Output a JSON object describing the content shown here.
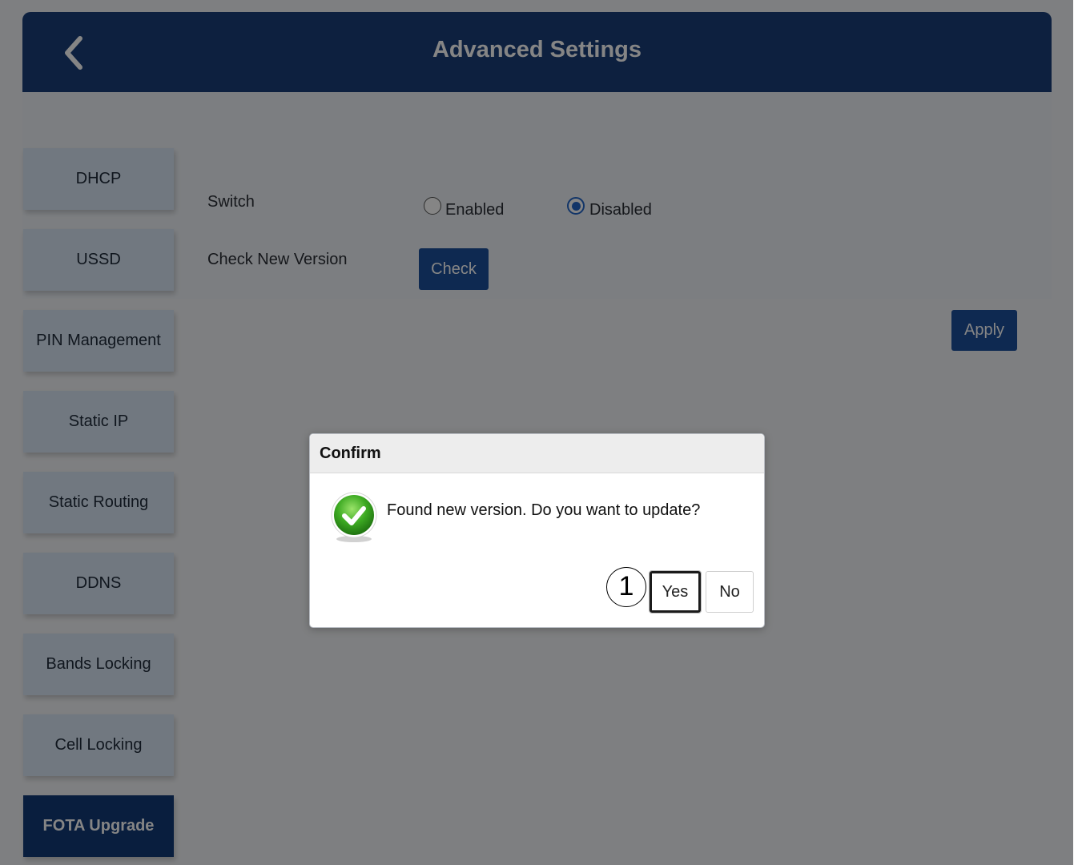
{
  "header": {
    "title": "Advanced Settings",
    "back_icon": "chevron-left-icon"
  },
  "sidebar": {
    "items": [
      {
        "label": "DHCP",
        "active": false
      },
      {
        "label": "USSD",
        "active": false
      },
      {
        "label": "PIN Management",
        "active": false
      },
      {
        "label": "Static IP",
        "active": false
      },
      {
        "label": "Static Routing",
        "active": false
      },
      {
        "label": "DDNS",
        "active": false
      },
      {
        "label": "Bands Locking",
        "active": false
      },
      {
        "label": "Cell Locking",
        "active": false
      },
      {
        "label": "FOTA Upgrade",
        "active": true
      }
    ]
  },
  "main": {
    "switch_label": "Switch",
    "switch_options": [
      {
        "label": "Enabled",
        "checked": false
      },
      {
        "label": "Disabled",
        "checked": true
      }
    ],
    "check_version_label": "Check New Version",
    "check_button": "Check",
    "apply_button": "Apply"
  },
  "dialog": {
    "title": "Confirm",
    "icon": "success-check-icon",
    "message": "Found new version. Do you want to update?",
    "yes_label": "Yes",
    "no_label": "No"
  },
  "annotation": {
    "step": "1"
  },
  "colors": {
    "header_bg": "#1a3f7a",
    "sidebar_bg": "#d9e7f5",
    "sidebar_active_bg": "#123a78",
    "button_blue": "#1c4f9c",
    "radio_checked": "#2466c8",
    "success_green": "#3daa22"
  }
}
